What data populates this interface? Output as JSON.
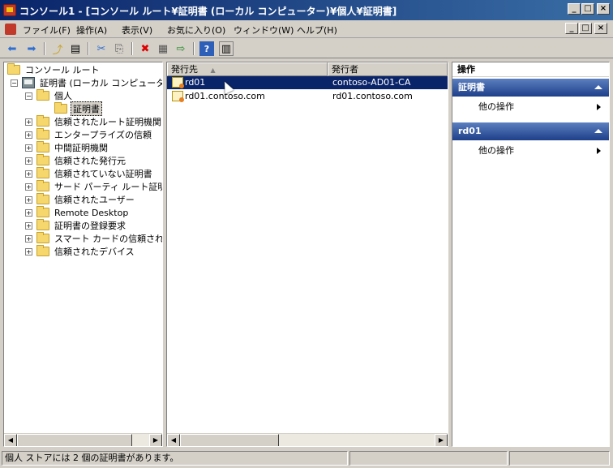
{
  "window": {
    "title": "コンソール1 - [コンソール ルート¥証明書 (ローカル コンピューター)¥個人¥証明書]",
    "controls": [
      "_",
      "□",
      "×"
    ]
  },
  "menu": {
    "items": [
      "ファイル(F)",
      "操作(A)",
      "表示(V)",
      "お気に入り(O)",
      "ウィンドウ(W)",
      "ヘルプ(H)"
    ],
    "mdi_controls": [
      "_",
      "□",
      "×"
    ]
  },
  "toolbar": {
    "icons": [
      "back-icon",
      "forward-icon",
      "up-folder-icon",
      "show-hide-tree-icon",
      "cut-icon",
      "copy-icon",
      "delete-icon",
      "properties-icon",
      "export-icon",
      "help-icon",
      "show-hide-action-pane-icon"
    ]
  },
  "tree": {
    "root": "コンソール ルート",
    "store": "証明書 (ローカル コンピューター)",
    "personal": "個人",
    "selected": "証明書",
    "items": [
      "信頼されたルート証明機関",
      "エンタープライズの信頼",
      "中間証明機関",
      "信頼された発行元",
      "信頼されていない証明書",
      "サード パーティ ルート証明機関",
      "信頼されたユーザー",
      "Remote Desktop",
      "証明書の登録要求",
      "スマート カードの信頼されたルート",
      "信頼されたデバイス"
    ]
  },
  "list": {
    "columns": [
      "発行先",
      "発行者"
    ],
    "rows": [
      {
        "issued_to": "rd01",
        "issued_by": "contoso-AD01-CA",
        "selected": true
      },
      {
        "issued_to": "rd01.contoso.com",
        "issued_by": "rd01.contoso.com",
        "selected": false
      }
    ]
  },
  "actions": {
    "title": "操作",
    "sections": [
      {
        "header": "証明書",
        "item": "他の操作"
      },
      {
        "header": "rd01",
        "item": "他の操作"
      }
    ]
  },
  "status": {
    "text": "個人 ストアには 2 個の証明書があります。"
  },
  "colors": {
    "title_bar": "#0a246a",
    "selection": "#0a246a",
    "action_header": "#1e3f8a",
    "folder": "#f5d76e"
  }
}
